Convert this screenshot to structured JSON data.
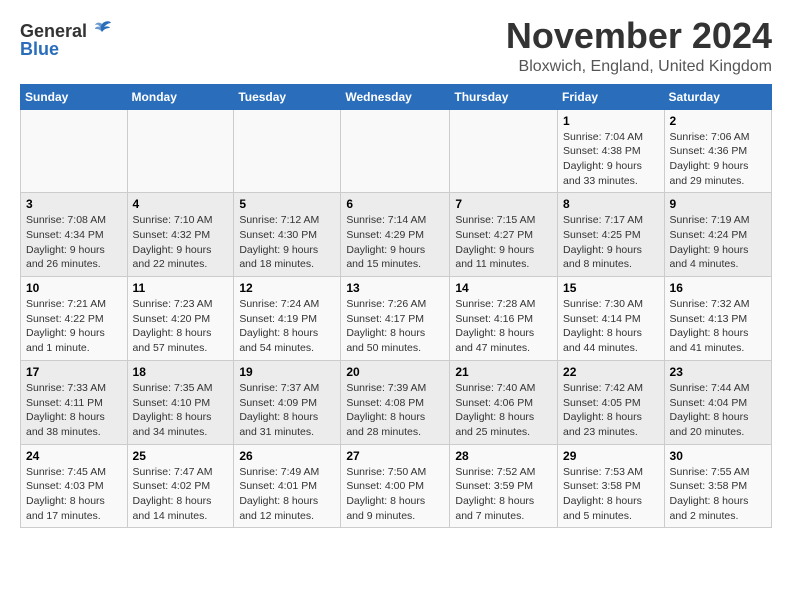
{
  "header": {
    "logo_general": "General",
    "logo_blue": "Blue",
    "month_title": "November 2024",
    "location": "Bloxwich, England, United Kingdom"
  },
  "calendar": {
    "days_of_week": [
      "Sunday",
      "Monday",
      "Tuesday",
      "Wednesday",
      "Thursday",
      "Friday",
      "Saturday"
    ],
    "weeks": [
      [
        {
          "day": "",
          "info": ""
        },
        {
          "day": "",
          "info": ""
        },
        {
          "day": "",
          "info": ""
        },
        {
          "day": "",
          "info": ""
        },
        {
          "day": "",
          "info": ""
        },
        {
          "day": "1",
          "info": "Sunrise: 7:04 AM\nSunset: 4:38 PM\nDaylight: 9 hours\nand 33 minutes."
        },
        {
          "day": "2",
          "info": "Sunrise: 7:06 AM\nSunset: 4:36 PM\nDaylight: 9 hours\nand 29 minutes."
        }
      ],
      [
        {
          "day": "3",
          "info": "Sunrise: 7:08 AM\nSunset: 4:34 PM\nDaylight: 9 hours\nand 26 minutes."
        },
        {
          "day": "4",
          "info": "Sunrise: 7:10 AM\nSunset: 4:32 PM\nDaylight: 9 hours\nand 22 minutes."
        },
        {
          "day": "5",
          "info": "Sunrise: 7:12 AM\nSunset: 4:30 PM\nDaylight: 9 hours\nand 18 minutes."
        },
        {
          "day": "6",
          "info": "Sunrise: 7:14 AM\nSunset: 4:29 PM\nDaylight: 9 hours\nand 15 minutes."
        },
        {
          "day": "7",
          "info": "Sunrise: 7:15 AM\nSunset: 4:27 PM\nDaylight: 9 hours\nand 11 minutes."
        },
        {
          "day": "8",
          "info": "Sunrise: 7:17 AM\nSunset: 4:25 PM\nDaylight: 9 hours\nand 8 minutes."
        },
        {
          "day": "9",
          "info": "Sunrise: 7:19 AM\nSunset: 4:24 PM\nDaylight: 9 hours\nand 4 minutes."
        }
      ],
      [
        {
          "day": "10",
          "info": "Sunrise: 7:21 AM\nSunset: 4:22 PM\nDaylight: 9 hours\nand 1 minute."
        },
        {
          "day": "11",
          "info": "Sunrise: 7:23 AM\nSunset: 4:20 PM\nDaylight: 8 hours\nand 57 minutes."
        },
        {
          "day": "12",
          "info": "Sunrise: 7:24 AM\nSunset: 4:19 PM\nDaylight: 8 hours\nand 54 minutes."
        },
        {
          "day": "13",
          "info": "Sunrise: 7:26 AM\nSunset: 4:17 PM\nDaylight: 8 hours\nand 50 minutes."
        },
        {
          "day": "14",
          "info": "Sunrise: 7:28 AM\nSunset: 4:16 PM\nDaylight: 8 hours\nand 47 minutes."
        },
        {
          "day": "15",
          "info": "Sunrise: 7:30 AM\nSunset: 4:14 PM\nDaylight: 8 hours\nand 44 minutes."
        },
        {
          "day": "16",
          "info": "Sunrise: 7:32 AM\nSunset: 4:13 PM\nDaylight: 8 hours\nand 41 minutes."
        }
      ],
      [
        {
          "day": "17",
          "info": "Sunrise: 7:33 AM\nSunset: 4:11 PM\nDaylight: 8 hours\nand 38 minutes."
        },
        {
          "day": "18",
          "info": "Sunrise: 7:35 AM\nSunset: 4:10 PM\nDaylight: 8 hours\nand 34 minutes."
        },
        {
          "day": "19",
          "info": "Sunrise: 7:37 AM\nSunset: 4:09 PM\nDaylight: 8 hours\nand 31 minutes."
        },
        {
          "day": "20",
          "info": "Sunrise: 7:39 AM\nSunset: 4:08 PM\nDaylight: 8 hours\nand 28 minutes."
        },
        {
          "day": "21",
          "info": "Sunrise: 7:40 AM\nSunset: 4:06 PM\nDaylight: 8 hours\nand 25 minutes."
        },
        {
          "day": "22",
          "info": "Sunrise: 7:42 AM\nSunset: 4:05 PM\nDaylight: 8 hours\nand 23 minutes."
        },
        {
          "day": "23",
          "info": "Sunrise: 7:44 AM\nSunset: 4:04 PM\nDaylight: 8 hours\nand 20 minutes."
        }
      ],
      [
        {
          "day": "24",
          "info": "Sunrise: 7:45 AM\nSunset: 4:03 PM\nDaylight: 8 hours\nand 17 minutes."
        },
        {
          "day": "25",
          "info": "Sunrise: 7:47 AM\nSunset: 4:02 PM\nDaylight: 8 hours\nand 14 minutes."
        },
        {
          "day": "26",
          "info": "Sunrise: 7:49 AM\nSunset: 4:01 PM\nDaylight: 8 hours\nand 12 minutes."
        },
        {
          "day": "27",
          "info": "Sunrise: 7:50 AM\nSunset: 4:00 PM\nDaylight: 8 hours\nand 9 minutes."
        },
        {
          "day": "28",
          "info": "Sunrise: 7:52 AM\nSunset: 3:59 PM\nDaylight: 8 hours\nand 7 minutes."
        },
        {
          "day": "29",
          "info": "Sunrise: 7:53 AM\nSunset: 3:58 PM\nDaylight: 8 hours\nand 5 minutes."
        },
        {
          "day": "30",
          "info": "Sunrise: 7:55 AM\nSunset: 3:58 PM\nDaylight: 8 hours\nand 2 minutes."
        }
      ]
    ]
  }
}
